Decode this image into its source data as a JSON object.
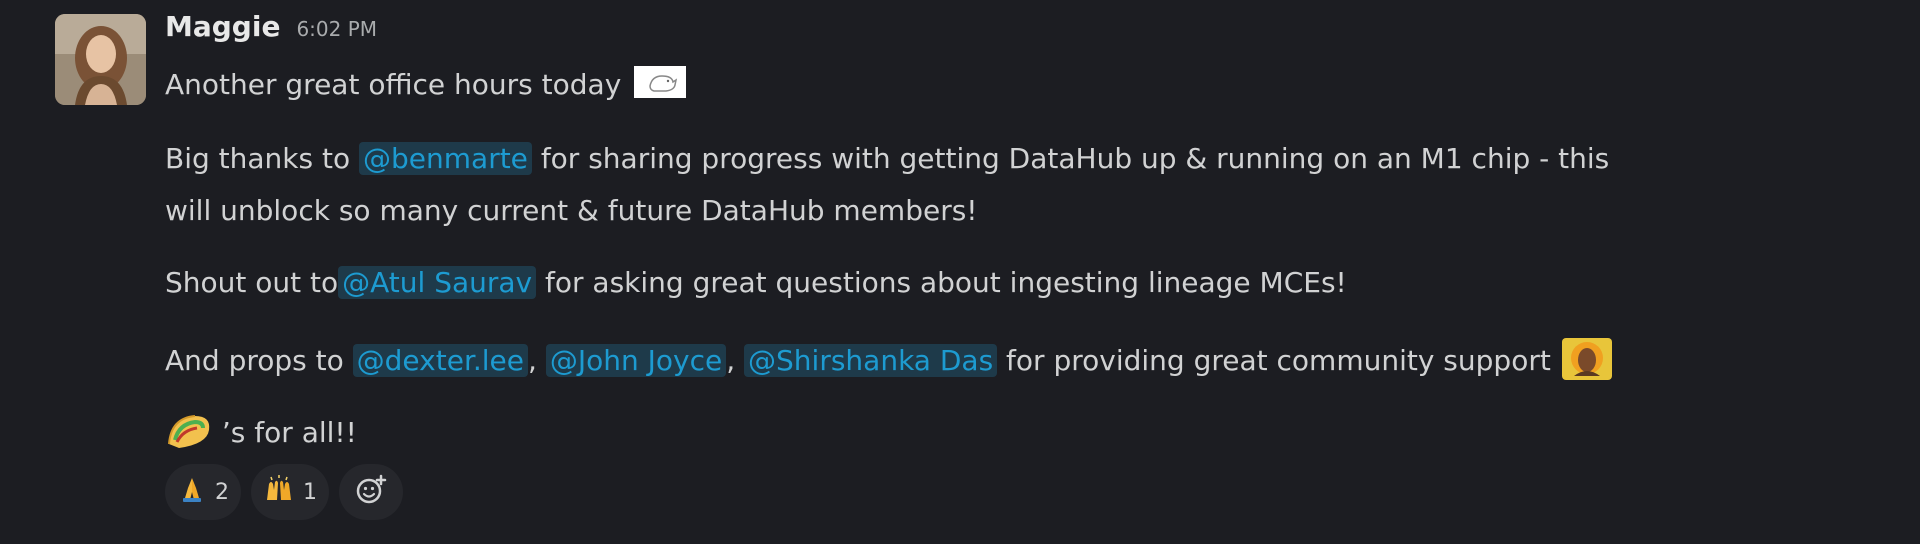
{
  "message": {
    "author": "Maggie",
    "timestamp": "6:02 PM",
    "line1": "Another great office hours today",
    "p2": {
      "a": "Big thanks to ",
      "mention": "@benmarte",
      "b": " for sharing progress with getting DataHub up & running on an M1 chip - this",
      "c": "will unblock so many current & future DataHub members!"
    },
    "p3": {
      "a": "Shout out to",
      "mention": "@Atul Saurav",
      "b": " for asking great questions about ingesting lineage MCEs!"
    },
    "p4": {
      "a": "And props to ",
      "m1": "@dexter.lee",
      "sep1": ", ",
      "m2": "@John Joyce",
      "sep2": ", ",
      "m3": "@Shirshanka Das",
      "b": " for providing great community support"
    },
    "p5": {
      "text": "’s for all!!"
    }
  },
  "reactions": [
    {
      "icon": "praying-hands-icon",
      "count": "2"
    },
    {
      "icon": "raised-hands-icon",
      "count": "1"
    }
  ],
  "colors": {
    "background": "#1c1d22",
    "mention": "#1d9bd1",
    "mention_bg": "#1e3a4a"
  }
}
